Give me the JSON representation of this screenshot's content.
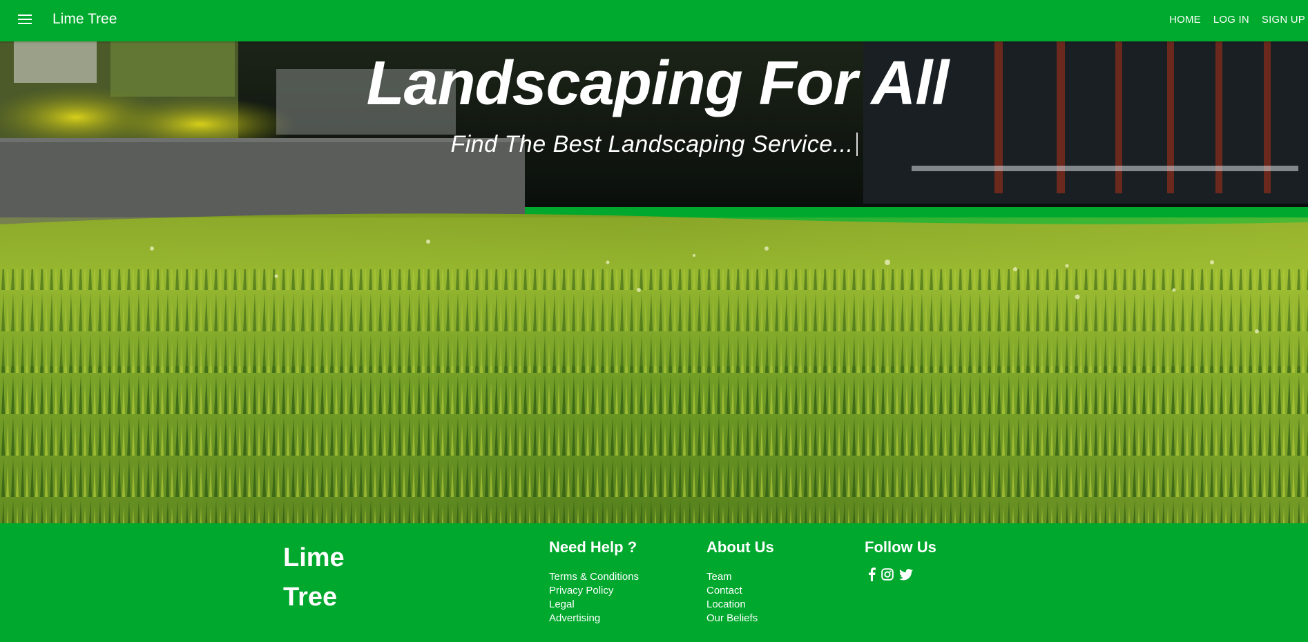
{
  "nav": {
    "brand": "Lime Tree",
    "menu_icon": "hamburger-menu-icon",
    "links": [
      "HOME",
      "LOG IN",
      "SIGN UP"
    ]
  },
  "hero": {
    "title": "Landscaping For All",
    "subtitle": "Find The Best Landscaping Service..."
  },
  "footer": {
    "logo_line1": "Lime",
    "logo_line2": "Tree",
    "help": {
      "heading": "Need Help ?",
      "links": [
        "Terms & Conditions",
        "Privacy Policy",
        "Legal",
        "Advertising"
      ]
    },
    "about": {
      "heading": "About Us",
      "links": [
        "Team",
        "Contact",
        "Location",
        "Our Beliefs"
      ]
    },
    "follow": {
      "heading": "Follow Us",
      "icons": [
        "facebook-icon",
        "instagram-icon",
        "twitter-icon"
      ]
    }
  },
  "colors": {
    "brand_green": "#00a82d",
    "text": "#ffffff"
  }
}
